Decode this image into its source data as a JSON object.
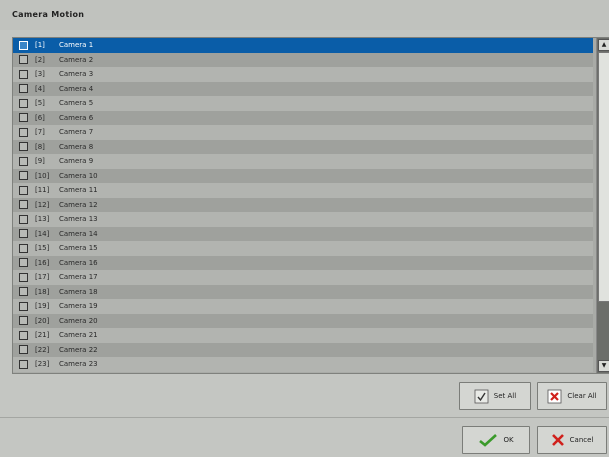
{
  "title": "Camera Motion",
  "rows": [
    {
      "index": "[1]",
      "name": "Camera 1"
    },
    {
      "index": "[2]",
      "name": "Camera 2"
    },
    {
      "index": "[3]",
      "name": "Camera 3"
    },
    {
      "index": "[4]",
      "name": "Camera 4"
    },
    {
      "index": "[5]",
      "name": "Camera 5"
    },
    {
      "index": "[6]",
      "name": "Camera 6"
    },
    {
      "index": "[7]",
      "name": "Camera 7"
    },
    {
      "index": "[8]",
      "name": "Camera 8"
    },
    {
      "index": "[9]",
      "name": "Camera 9"
    },
    {
      "index": "[10]",
      "name": "Camera 10"
    },
    {
      "index": "[11]",
      "name": "Camera 11"
    },
    {
      "index": "[12]",
      "name": "Camera 12"
    },
    {
      "index": "[13]",
      "name": "Camera 13"
    },
    {
      "index": "[14]",
      "name": "Camera 14"
    },
    {
      "index": "[15]",
      "name": "Camera 15"
    },
    {
      "index": "[16]",
      "name": "Camera 16"
    },
    {
      "index": "[17]",
      "name": "Camera 17"
    },
    {
      "index": "[18]",
      "name": "Camera 18"
    },
    {
      "index": "[19]",
      "name": "Camera 19"
    },
    {
      "index": "[20]",
      "name": "Camera 20"
    },
    {
      "index": "[21]",
      "name": "Camera 21"
    },
    {
      "index": "[22]",
      "name": "Camera 22"
    },
    {
      "index": "[23]",
      "name": "Camera 23"
    }
  ],
  "selected_row": "[1]",
  "buttons": {
    "set_all": "Set All",
    "clear_all": "Clear All",
    "ok": "OK",
    "cancel": "Cancel"
  },
  "icons": {
    "set_all": "hand-check-icon",
    "clear_all": "red-x-icon",
    "ok": "green-check-icon",
    "cancel": "red-x-icon"
  },
  "colors": {
    "selection": "#0a5da8",
    "background": "#c4c6c2"
  }
}
